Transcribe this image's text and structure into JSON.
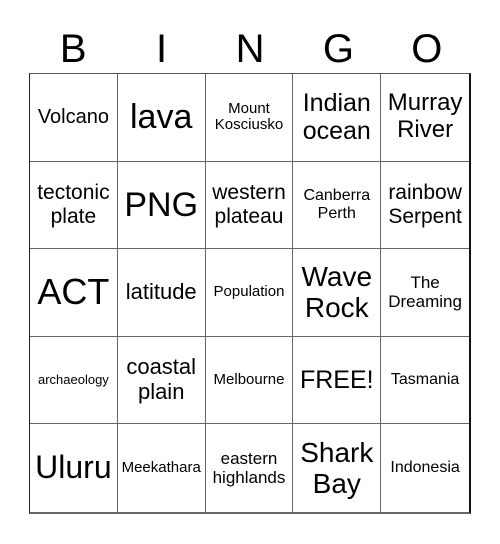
{
  "header": {
    "letters": [
      "B",
      "I",
      "N",
      "G",
      "O"
    ]
  },
  "cells": [
    [
      "Volcano",
      "lava",
      "Mount Kosciusko",
      "Indian ocean",
      "Murray River"
    ],
    [
      "tectonic plate",
      "PNG",
      "western plateau",
      "Canberra Perth",
      "rainbow Serpent"
    ],
    [
      "ACT",
      "latitude",
      "Population",
      "Wave Rock",
      "The Dreaming"
    ],
    [
      "archaeology",
      "coastal plain",
      "Melbourne",
      "FREE!",
      "Tasmania"
    ],
    [
      "Uluru",
      "Meekathara",
      "eastern highlands",
      "Shark Bay",
      "Indonesia"
    ]
  ]
}
